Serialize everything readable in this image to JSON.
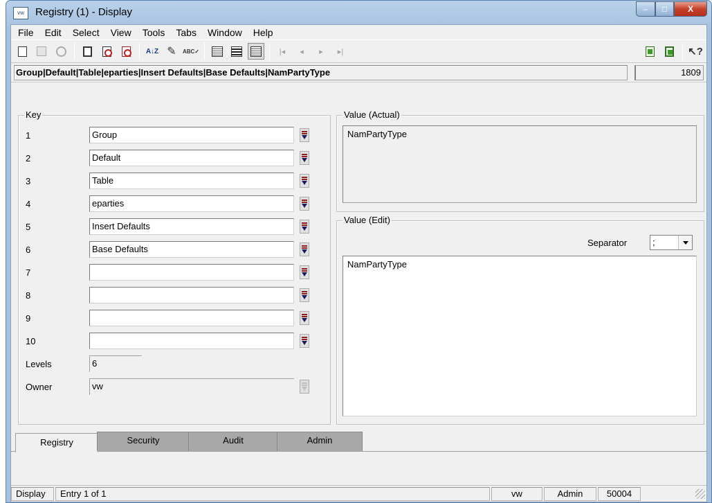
{
  "window": {
    "title": "Registry (1) - Display",
    "icon_text": "vw",
    "controls": {
      "minimize": "–",
      "maximize": "□",
      "close": "X"
    }
  },
  "menu": [
    "File",
    "Edit",
    "Select",
    "View",
    "Tools",
    "Tabs",
    "Window",
    "Help"
  ],
  "toolbar": {
    "icons": [
      "new-icon",
      "save-icon",
      "cancel-icon",
      "export-icon",
      "delete-icon",
      "copy-icon",
      "sort-icon",
      "edit-icon",
      "spellcheck-icon",
      "view-list-icon",
      "view-form-icon",
      "view-detail-icon",
      "first-record-icon",
      "prev-record-icon",
      "next-record-icon",
      "last-record-icon",
      "report-icon",
      "report-green-icon",
      "whats-this-icon"
    ],
    "glyphs": {
      "sort": "A↓Z",
      "edit": "✎",
      "spell": "ABC✓",
      "first": "|◂",
      "prev": "◂",
      "next": "▸",
      "last": "▸|",
      "help": "↖?"
    }
  },
  "path": {
    "value": "Group|Default|Table|eparties|Insert Defaults|Base Defaults|NamPartyType",
    "count": "1809"
  },
  "key_group": {
    "title": "Key",
    "rows": [
      {
        "num": "1",
        "value": "Group"
      },
      {
        "num": "2",
        "value": "Default"
      },
      {
        "num": "3",
        "value": "Table"
      },
      {
        "num": "4",
        "value": "eparties"
      },
      {
        "num": "5",
        "value": "Insert Defaults"
      },
      {
        "num": "6",
        "value": "Base Defaults"
      },
      {
        "num": "7",
        "value": ""
      },
      {
        "num": "8",
        "value": ""
      },
      {
        "num": "9",
        "value": ""
      },
      {
        "num": "10",
        "value": ""
      }
    ],
    "levels_label": "Levels",
    "levels_value": "6",
    "owner_label": "Owner",
    "owner_value": "vw"
  },
  "value_actual": {
    "title": "Value (Actual)",
    "text": "NamPartyType"
  },
  "value_edit": {
    "title": "Value (Edit)",
    "separator_label": "Separator",
    "separator_value": ";",
    "text": "NamPartyType"
  },
  "tabs": [
    {
      "label": "Registry",
      "active": true
    },
    {
      "label": "Security",
      "active": false
    },
    {
      "label": "Audit",
      "active": false
    },
    {
      "label": "Admin",
      "active": false
    }
  ],
  "status": {
    "mode": "Display",
    "entry": "Entry 1 of 1",
    "user": "vw",
    "role": "Admin",
    "code": "50004"
  },
  "colors": {
    "titlebar": "#b9d1ea",
    "close_button": "#c4412a",
    "tab_inactive": "#a8a8a8"
  }
}
